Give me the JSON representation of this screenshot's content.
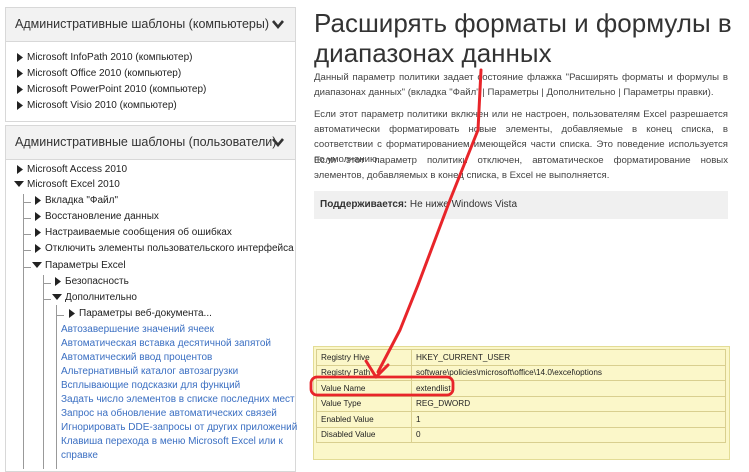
{
  "sidebar": {
    "computers_panel": {
      "title": "Административные шаблоны (компьютеры)",
      "items": [
        "Microsoft InfoPath 2010 (компьютер)",
        "Microsoft Office 2010 (компьютер)",
        "Microsoft PowerPoint 2010 (компьютер)",
        "Microsoft Visio 2010 (компьютер)"
      ]
    },
    "users_panel": {
      "title": "Административные шаблоны (пользователи)",
      "access": "Microsoft Access 2010",
      "excel": "Microsoft Excel 2010",
      "excel_children": [
        "Вкладка \"Файл\"",
        "Восстановление данных",
        "Настраиваемые сообщения об ошибках",
        "Отключить элементы пользовательского интерфейса"
      ],
      "excel_options": "Параметры Excel",
      "security": "Безопасность",
      "advanced": "Дополнительно",
      "web_options": "Параметры веб-документа...",
      "policy_links": [
        "Автозавершение значений ячеек",
        "Автоматическая вставка десятичной запятой",
        "Автоматический ввод процентов",
        "Альтернативный каталог автозагрузки",
        "Всплывающие подсказки для функций",
        "Задать число элементов в списке последних мест",
        "Запрос на обновление автоматических связей",
        "Игнорировать DDE-запросы от других приложений",
        "Клавиша перехода в меню Microsoft Excel или к",
        "справке"
      ]
    }
  },
  "content": {
    "title_line1": "Расширять форматы и формулы в",
    "title_line2": "диапазонах данных",
    "para1": "Данный параметр политики задает состояние флажка \"Расширять форматы и формулы в диапазонах данных\" (вкладка \"Файл\" | Параметры | Дополнительно | Параметры правки).",
    "para2": "Если этот параметр политики включен или не настроен, пользователям Excel разрешается автоматически форматировать новые элементы, добавляемые в конец списка, в соответствии с форматированием имеющейся части списка. Это поведение используется по умолчанию.",
    "para3": "Если этот параметр политики отключен, автоматическое форматирование новых элементов, добавляемых в конец списка, в Excel не выполняется.",
    "supported_label": "Поддерживается:",
    "supported_value": "Не ниже Windows Vista",
    "registry": [
      {
        "key": "Registry Hive",
        "value": "HKEY_CURRENT_USER"
      },
      {
        "key": "Registry Path",
        "value": "software\\policies\\microsoft\\office\\14.0\\excel\\options"
      },
      {
        "key": "Value Name",
        "value": "extendlist"
      },
      {
        "key": "Value Type",
        "value": "REG_DWORD"
      },
      {
        "key": "Enabled Value",
        "value": "1"
      },
      {
        "key": "Disabled Value",
        "value": "0"
      }
    ]
  },
  "colors": {
    "annotation": "#e8252a",
    "link": "#3b6fc2",
    "registry_bg": "#fbf7c9"
  }
}
